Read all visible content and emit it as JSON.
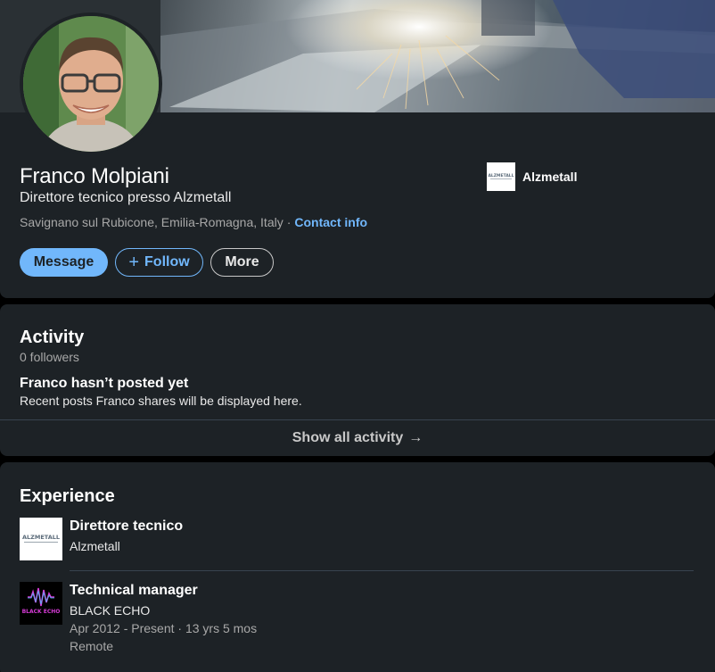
{
  "profile": {
    "name": "Franco Molpiani",
    "headline": "Direttore tecnico presso Alzmetall",
    "location": "Savignano sul Rubicone, Emilia-Romagna, Italy",
    "separator": "·",
    "contact_info": "Contact info",
    "current_company": "Alzmetall",
    "actions": {
      "message": "Message",
      "follow": "Follow",
      "more": "More"
    }
  },
  "activity": {
    "title": "Activity",
    "followers": "0 followers",
    "empty_title": "Franco hasn’t posted yet",
    "empty_desc": "Recent posts Franco shares will be displayed here.",
    "show_all": "Show all activity",
    "show_all_arrow": "→"
  },
  "experience": {
    "title": "Experience",
    "items": [
      {
        "role": "Direttore tecnico",
        "company": "Alzmetall",
        "logo": "alzmetall-logo"
      },
      {
        "role": "Technical manager",
        "company": "BLACK ECHO",
        "dates": "Apr 2012 - Present · 13 yrs 5 mos",
        "location": "Remote",
        "logo": "black-echo-logo"
      }
    ]
  },
  "logos": {
    "alzmetall_wordmark": "ALZMETALL",
    "black_echo_wordmark": "BLACK ECHO"
  },
  "colors": {
    "card_bg": "#1d2226",
    "accent": "#71b7fb",
    "text_primary": "#ffffff",
    "text_secondary": "#a8a8a8"
  }
}
